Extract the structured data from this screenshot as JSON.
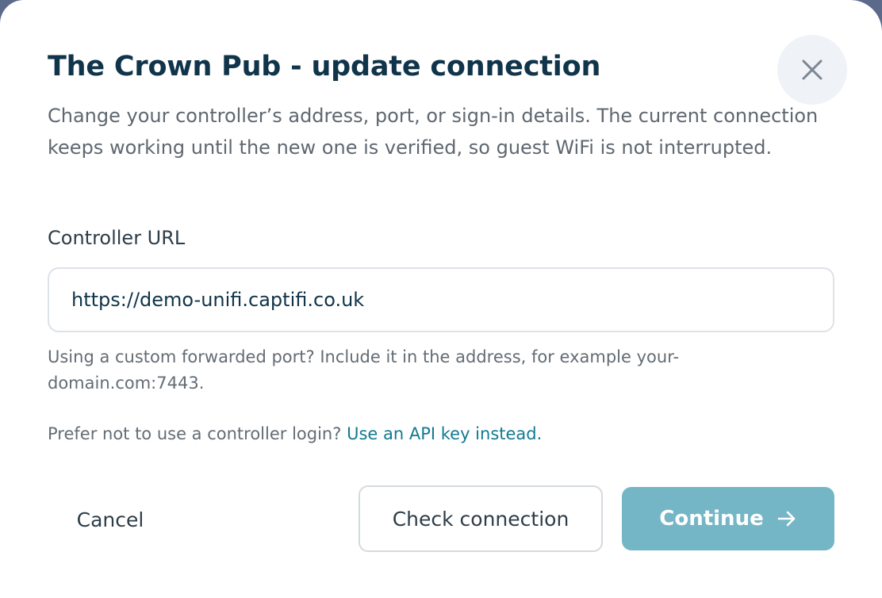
{
  "dialog": {
    "title": "The Crown Pub - update connection",
    "description": "Change your controller’s address, port, or sign-in details. The current connection keeps working until the new one is verified, so guest WiFi is not interrupted.",
    "close_icon": "close-icon"
  },
  "controller_url": {
    "label": "Controller URL",
    "value": "https://demo-unifi.captifi.co.uk",
    "hint": "Using a custom forwarded port? Include it in the address, for example your-domain.com:7443."
  },
  "api_key": {
    "prompt": "Prefer not to use a controller login?",
    "link_label": "Use an API key instead."
  },
  "actions": {
    "cancel_label": "Cancel",
    "check_label": "Check connection",
    "continue_label": "Continue",
    "continue_icon": "arrow-right-icon"
  },
  "colors": {
    "heading": "#10344a",
    "link": "#127a90",
    "primary_button_disabled": "#75b6c6",
    "close_button_bg": "#eff2f6"
  }
}
